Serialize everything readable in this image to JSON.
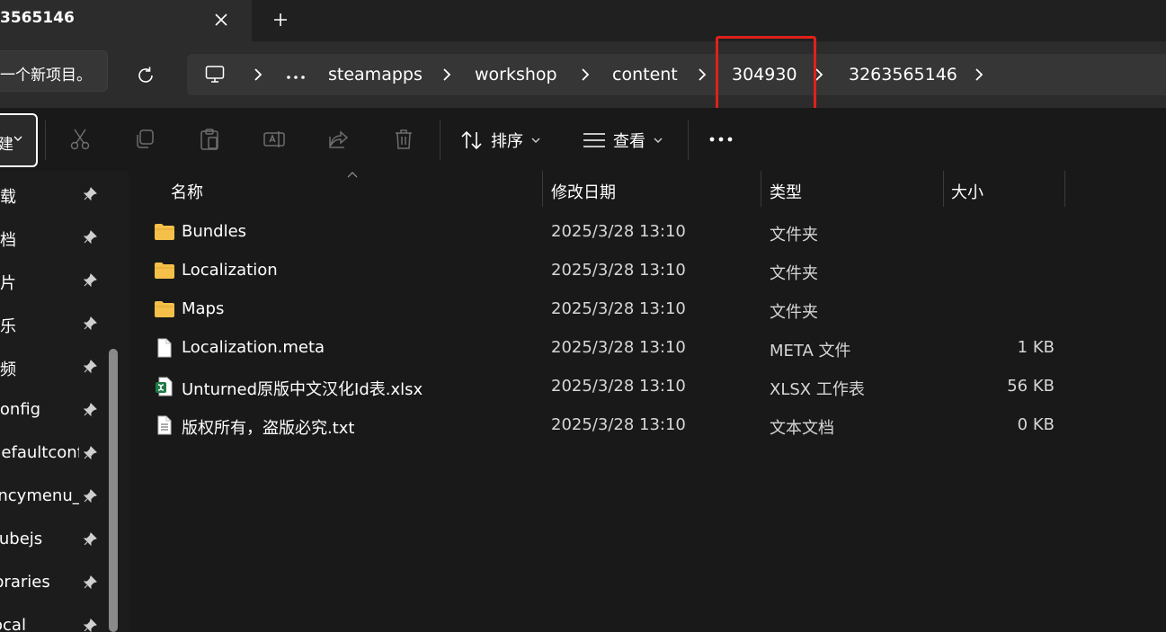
{
  "tab": {
    "title": "3565146"
  },
  "nav": {
    "left_box_text": "一个新项目。",
    "breadcrumb": [
      "steamapps",
      "workshop",
      "content",
      "304930",
      "3263565146"
    ]
  },
  "toolbar": {
    "new_label": "建",
    "sort_label": "排序",
    "view_label": "查看"
  },
  "sidebar": {
    "items": [
      {
        "label": "下载"
      },
      {
        "label": "文档"
      },
      {
        "label": "图片"
      },
      {
        "label": "音乐"
      },
      {
        "label": "视频"
      },
      {
        "label": "config"
      },
      {
        "label": "defaultconfig"
      },
      {
        "label": "fancymenu_"
      },
      {
        "label": "kubejs"
      },
      {
        "label": "libraries"
      },
      {
        "label": "local"
      }
    ]
  },
  "columns": {
    "name": "名称",
    "date": "修改日期",
    "type": "类型",
    "size": "大小"
  },
  "files": [
    {
      "icon": "folder-icon",
      "name": "Bundles",
      "date": "2025/3/28 13:10",
      "type": "文件夹",
      "size": ""
    },
    {
      "icon": "folder-icon",
      "name": "Localization",
      "date": "2025/3/28 13:10",
      "type": "文件夹",
      "size": ""
    },
    {
      "icon": "folder-icon",
      "name": "Maps",
      "date": "2025/3/28 13:10",
      "type": "文件夹",
      "size": ""
    },
    {
      "icon": "file-icon",
      "name": "Localization.meta",
      "date": "2025/3/28 13:10",
      "type": "META 文件",
      "size": "1 KB"
    },
    {
      "icon": "spreadsheet-icon",
      "name": "Unturned原版中文汉化Id表.xlsx",
      "date": "2025/3/28 13:10",
      "type": "XLSX 工作表",
      "size": "56 KB"
    },
    {
      "icon": "text-file-icon",
      "name": "版权所有，盗版必究.txt",
      "date": "2025/3/28 13:10",
      "type": "文本文档",
      "size": "0 KB"
    }
  ],
  "colors": {
    "highlight": "#e0211b",
    "folder": "#f4c04a",
    "excel": "#1e7a45"
  }
}
